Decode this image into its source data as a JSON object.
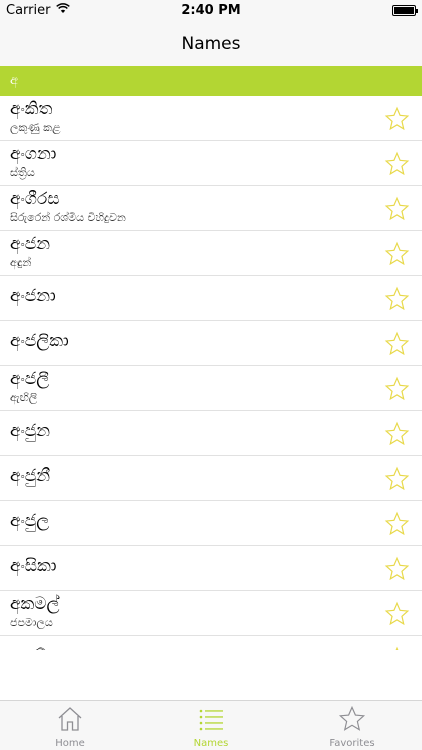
{
  "status_bar": {
    "carrier": "Carrier",
    "time": "2:40 PM"
  },
  "nav": {
    "title": "Names"
  },
  "section": {
    "header": "අ"
  },
  "names": [
    {
      "name": "අංකිත",
      "meaning": "ලකුණු කළ"
    },
    {
      "name": "අංගනා",
      "meaning": "ස්ත්‍රිය"
    },
    {
      "name": "අංගීරස",
      "meaning": "සිරුරෙන් රශ්මිය විහිදුවන"
    },
    {
      "name": "අංජන",
      "meaning": "අඳුන්"
    },
    {
      "name": "අංජනා",
      "meaning": ""
    },
    {
      "name": "අංජලිකා",
      "meaning": ""
    },
    {
      "name": "අංජලී",
      "meaning": "ඇඟිලි"
    },
    {
      "name": "අංජුන",
      "meaning": ""
    },
    {
      "name": "අංජුනී",
      "meaning": ""
    },
    {
      "name": "අංජුල",
      "meaning": ""
    },
    {
      "name": "අංසිකා",
      "meaning": ""
    },
    {
      "name": "අකමල්",
      "meaning": "ජපමාලය"
    },
    {
      "name": "අකම්පන",
      "meaning": ""
    }
  ],
  "colors": {
    "accent": "#b3d633",
    "star": "#e8d94a"
  },
  "tabs": [
    {
      "label": "Home",
      "icon": "house-icon",
      "active": false
    },
    {
      "label": "Names",
      "icon": "list-icon",
      "active": true
    },
    {
      "label": "Favorites",
      "icon": "star-icon",
      "active": false
    }
  ]
}
